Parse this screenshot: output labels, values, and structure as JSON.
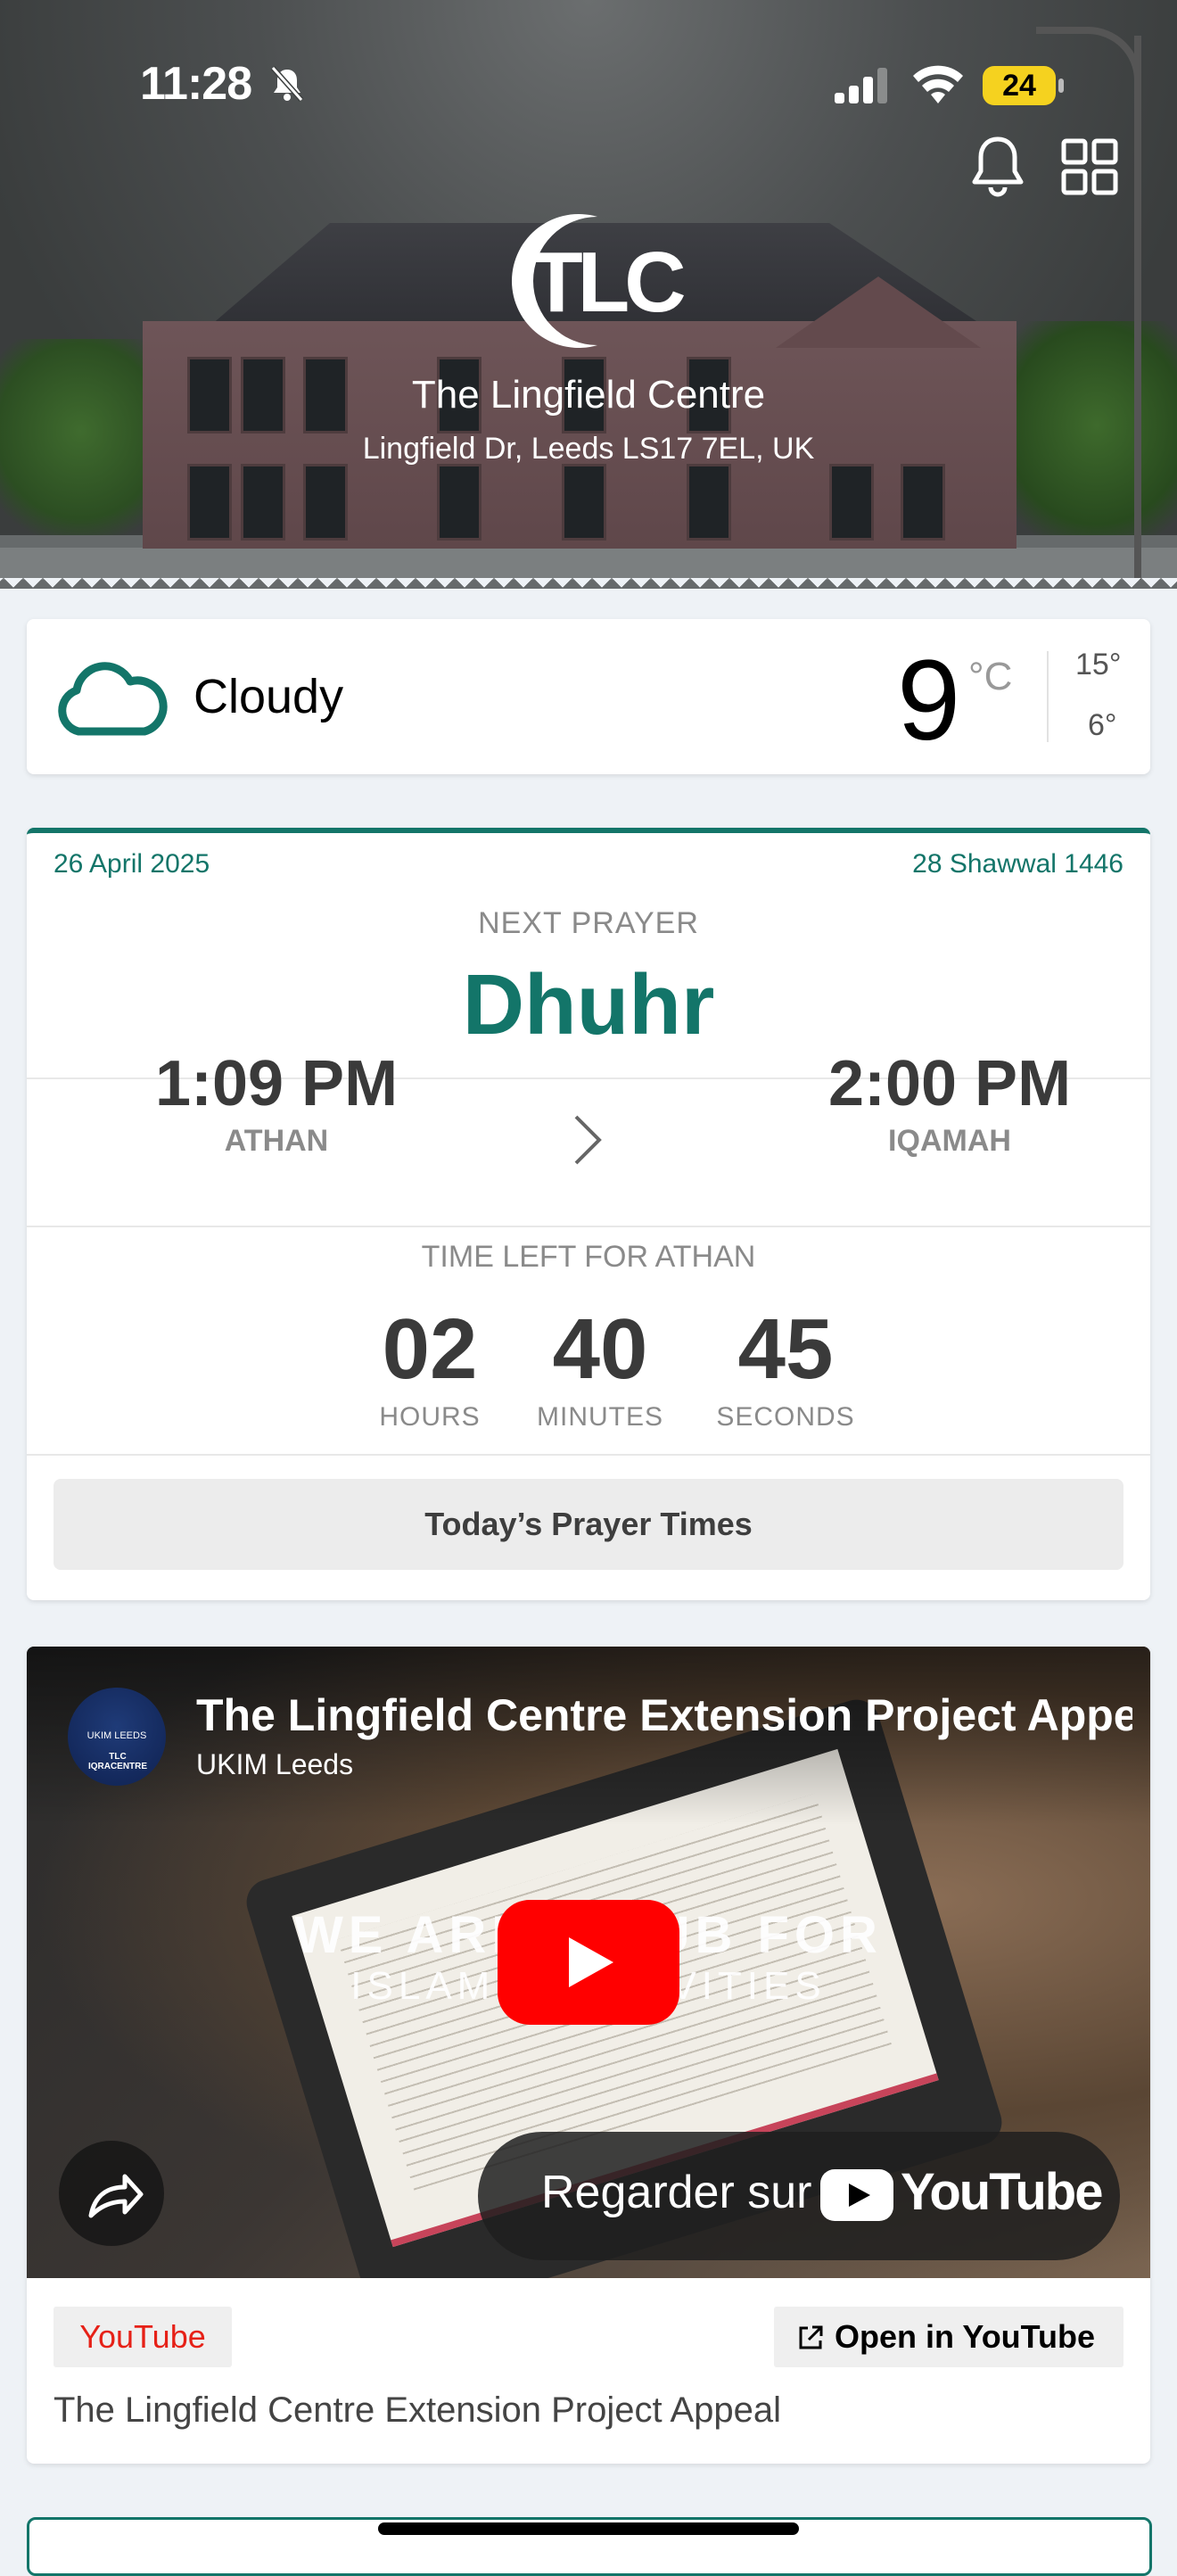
{
  "status_bar": {
    "time": "11:28",
    "battery": "24"
  },
  "hero": {
    "logo_text": "TLC",
    "centre_name": "The Lingfield Centre",
    "address": "Lingfield Dr, Leeds LS17 7EL, UK"
  },
  "weather": {
    "condition": "Cloudy",
    "temperature": "9",
    "unit": "°C",
    "high": "15°",
    "low": "6°"
  },
  "prayer": {
    "date": "26 April 2025",
    "hijri_date": "28 Shawwal 1446",
    "next_label": "NEXT PRAYER",
    "next_name": "Dhuhr",
    "athan_time": "1:09 PM",
    "athan_label": "ATHAN",
    "iqamah_time": "2:00 PM",
    "iqamah_label": "IQAMAH",
    "time_left_label": "TIME LEFT FOR ATHAN",
    "countdown": {
      "hours": "02",
      "hours_label": "HOURS",
      "minutes": "40",
      "minutes_label": "MINUTES",
      "seconds": "45",
      "seconds_label": "SECONDS"
    },
    "button_label": "Today’s Prayer Times"
  },
  "video": {
    "title": "The Lingfield Centre Extension Project Appeal",
    "channel": "UKIM Leeds",
    "avatar_text_1": "UKIM LEEDS",
    "avatar_text_2": "TLC IQRACENTRE",
    "overlay_line1": "WE ARE A HUB FOR",
    "overlay_line2": "ISLAMIC ACTIVITIES",
    "watch_on": "Regarder sur",
    "youtube_wordmark": "YouTube",
    "source_badge": "YouTube",
    "open_button": "Open in YouTube",
    "description": "The Lingfield Centre Extension Project Appeal"
  },
  "colors": {
    "accent": "#137569",
    "youtube_red": "#e62117",
    "battery_yellow": "#f5d21f",
    "background": "#eef2f6"
  },
  "icons": [
    "bell-slash-icon",
    "signal-icon",
    "wifi-icon",
    "bell-icon",
    "grid-icon",
    "cloud-icon",
    "chevron-right-icon",
    "play-icon",
    "share-icon",
    "external-link-icon"
  ]
}
